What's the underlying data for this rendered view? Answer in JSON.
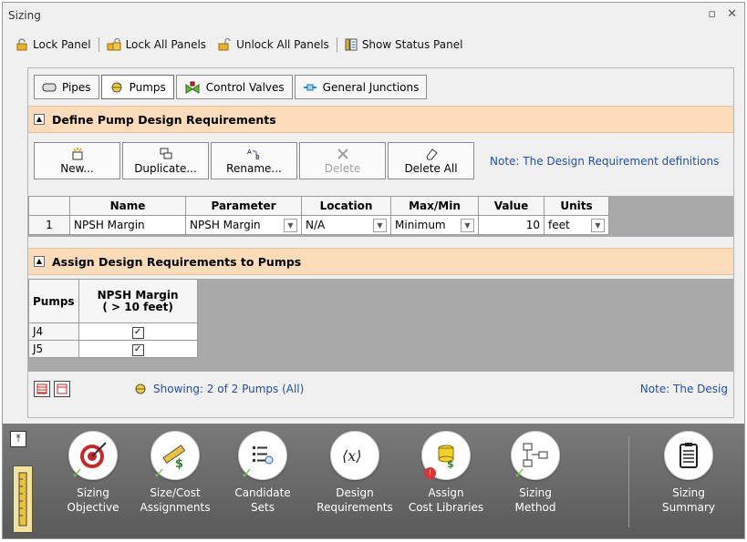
{
  "window": {
    "title": "Sizing"
  },
  "toolbar": {
    "lock_panel": "Lock Panel",
    "lock_all": "Lock All Panels",
    "unlock_all": "Unlock All Panels",
    "show_status": "Show Status Panel"
  },
  "tabs": [
    "Pipes",
    "Pumps",
    "Control Valves",
    "General Junctions"
  ],
  "define_section": {
    "title": "Define Pump Design Requirements",
    "buttons": {
      "new": "New...",
      "duplicate": "Duplicate...",
      "rename": "Rename...",
      "delete": "Delete",
      "delete_all": "Delete All"
    },
    "note": "Note: The Design Requirement definitions",
    "columns": [
      "",
      "Name",
      "Parameter",
      "Location",
      "Max/Min",
      "Value",
      "Units"
    ],
    "rows": [
      {
        "num": "1",
        "name": "NPSH Margin",
        "parameter": "NPSH Margin",
        "location": "N/A",
        "maxmin": "Minimum",
        "value": "10",
        "units": "feet"
      }
    ]
  },
  "assign_section": {
    "title": "Assign Design Requirements to Pumps",
    "col_pumps": "Pumps",
    "col_req_line1": "NPSH Margin",
    "col_req_line2": "( > 10 feet)",
    "rows": [
      {
        "pump": "J4",
        "checked": true
      },
      {
        "pump": "J5",
        "checked": true
      }
    ],
    "showing": "Showing: 2 of 2 Pumps (All)",
    "note": "Note: The Desig"
  },
  "nav": [
    {
      "line1": "Sizing",
      "line2": "Objective",
      "icon": "target-icon"
    },
    {
      "line1": "Size/Cost",
      "line2": "Assignments",
      "icon": "ruler-dollar-icon"
    },
    {
      "line1": "Candidate",
      "line2": "Sets",
      "icon": "list-search-icon"
    },
    {
      "line1": "Design",
      "line2": "Requirements",
      "icon": "variable-x-icon"
    },
    {
      "line1": "Assign",
      "line2": "Cost Libraries",
      "icon": "cost-library-icon"
    },
    {
      "line1": "Sizing",
      "line2": "Method",
      "icon": "flowchart-icon"
    },
    {
      "line1": "Sizing",
      "line2": "Summary",
      "icon": "clipboard-icon"
    }
  ],
  "colors": {
    "section_header": "#fcdcb8",
    "note_blue": "#1f4fb5",
    "navbar": "#6a6a6a"
  }
}
